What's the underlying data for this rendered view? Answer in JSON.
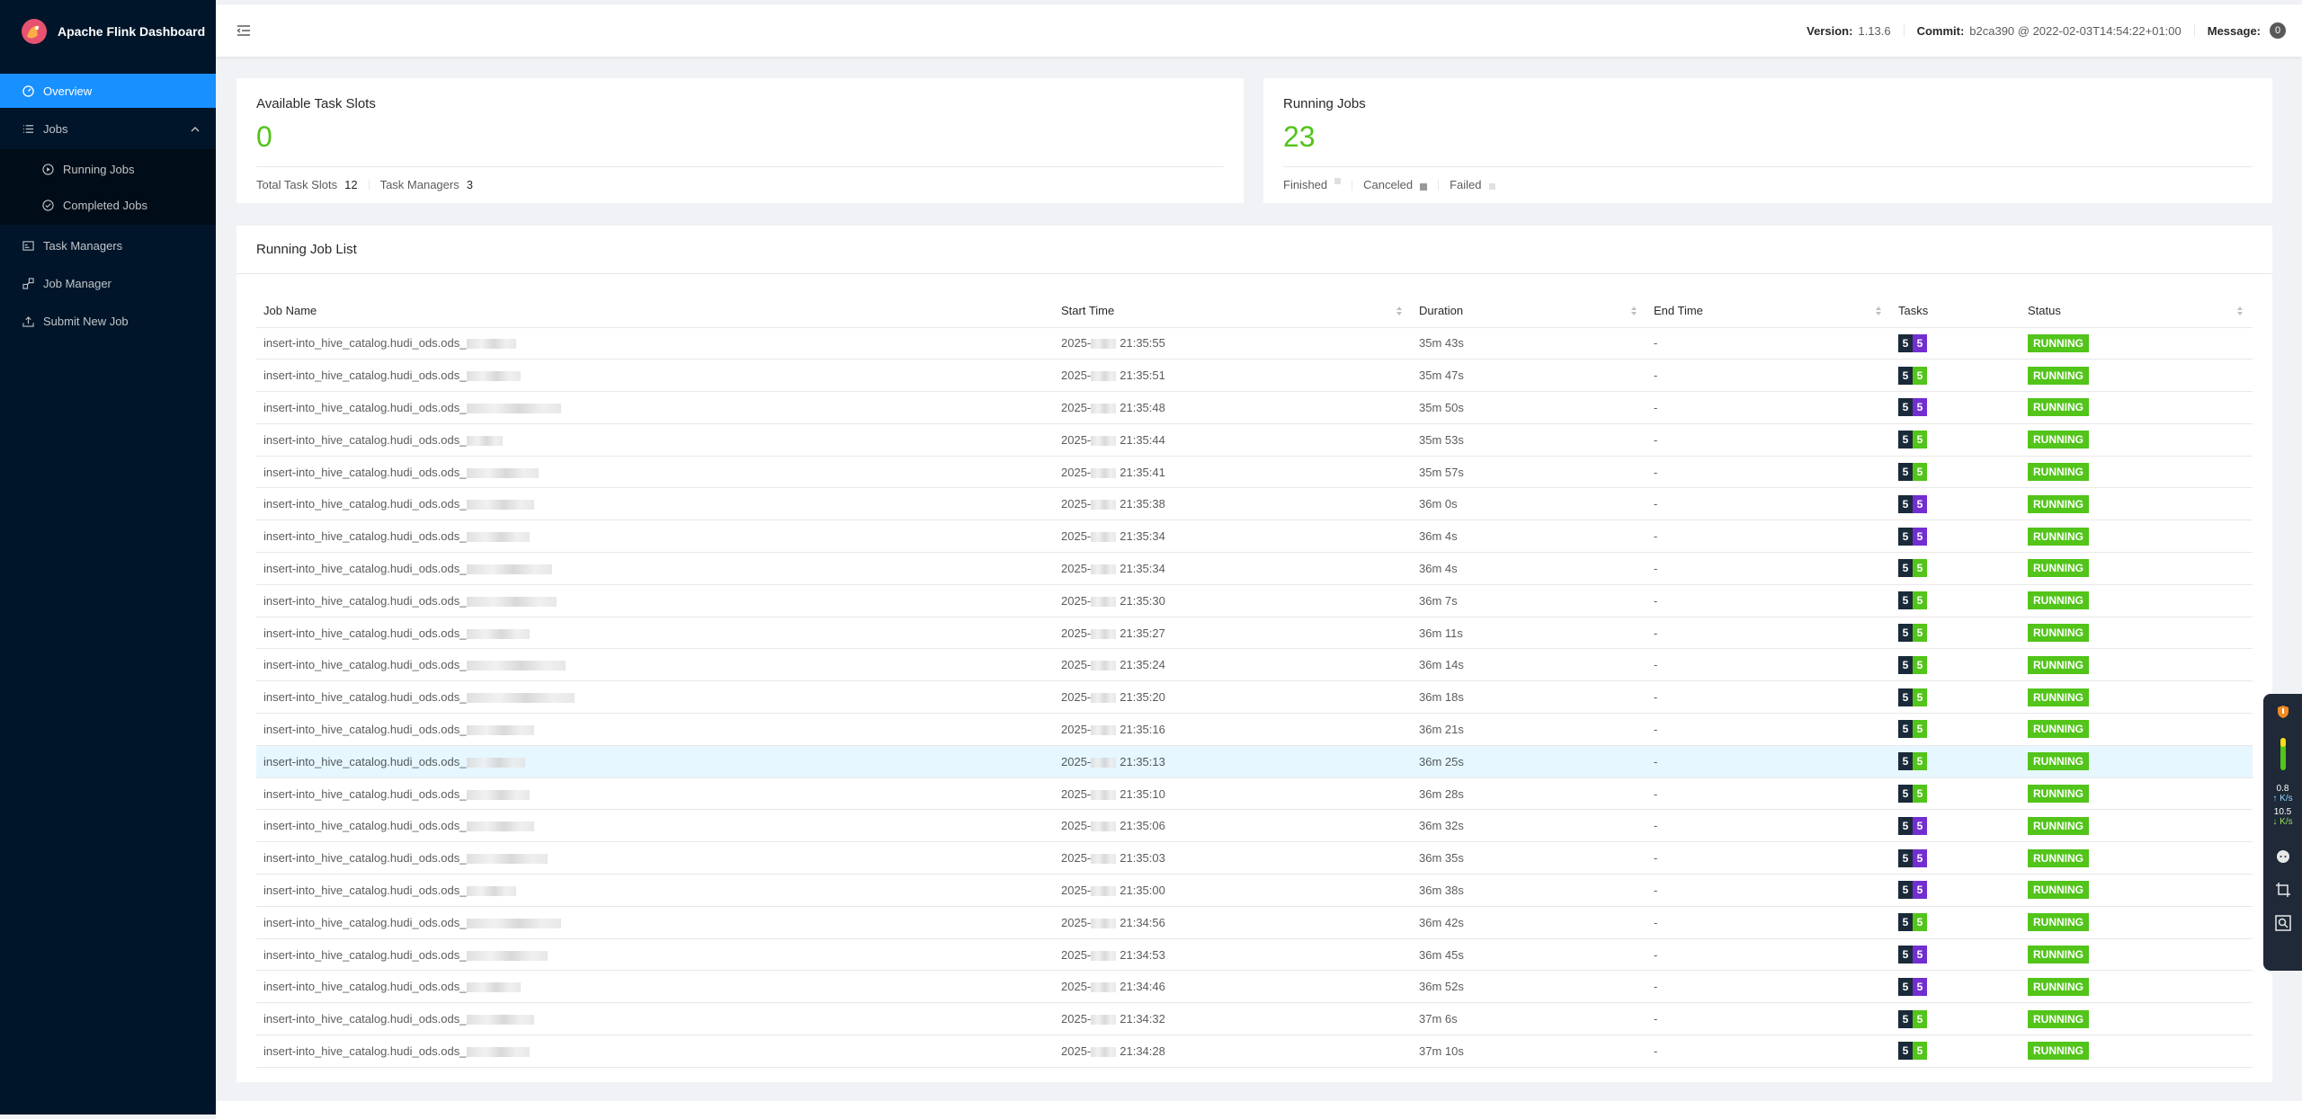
{
  "app": {
    "title": "Apache Flink Dashboard"
  },
  "sidebar": {
    "overview": "Overview",
    "jobs": "Jobs",
    "running_jobs": "Running Jobs",
    "completed_jobs": "Completed Jobs",
    "task_managers": "Task Managers",
    "job_manager": "Job Manager",
    "submit_new_job": "Submit New Job"
  },
  "header": {
    "version_label": "Version:",
    "version": "1.13.6",
    "commit_label": "Commit:",
    "commit": "b2ca390 @ 2022-02-03T14:54:22+01:00",
    "message_label": "Message:",
    "message_count": "0"
  },
  "slots": {
    "title": "Available Task Slots",
    "value": "0",
    "total_label": "Total Task Slots",
    "total_value": "12",
    "tm_label": "Task Managers",
    "tm_value": "3"
  },
  "running": {
    "title": "Running Jobs",
    "value": "23",
    "finished_label": "Finished",
    "canceled_label": "Canceled",
    "failed_label": "Failed"
  },
  "job_list": {
    "title": "Running Job List",
    "columns": [
      "Job Name",
      "Start Time",
      "Duration",
      "End Time",
      "Tasks",
      "Status"
    ],
    "rows": [
      {
        "name": "insert-into_hive_catalog.hudi_ods.ods_",
        "start_prefix": "2025-",
        "start_time": "21:35:55",
        "duration": "35m 43s",
        "end": "-",
        "tasks_a": "5",
        "tasks_b": "5",
        "tasks_color": "purple",
        "status": "RUNNING"
      },
      {
        "name": "insert-into_hive_catalog.hudi_ods.ods_",
        "start_prefix": "2025-",
        "start_time": "21:35:51",
        "duration": "35m 47s",
        "end": "-",
        "tasks_a": "5",
        "tasks_b": "5",
        "tasks_color": "green",
        "status": "RUNNING"
      },
      {
        "name": "insert-into_hive_catalog.hudi_ods.ods_",
        "start_prefix": "2025-",
        "start_time": "21:35:48",
        "duration": "35m 50s",
        "end": "-",
        "tasks_a": "5",
        "tasks_b": "5",
        "tasks_color": "purple",
        "status": "RUNNING"
      },
      {
        "name": "insert-into_hive_catalog.hudi_ods.ods_",
        "start_prefix": "2025-",
        "start_time": "21:35:44",
        "duration": "35m 53s",
        "end": "-",
        "tasks_a": "5",
        "tasks_b": "5",
        "tasks_color": "green",
        "status": "RUNNING"
      },
      {
        "name": "insert-into_hive_catalog.hudi_ods.ods_",
        "start_prefix": "2025-",
        "start_time": "21:35:41",
        "duration": "35m 57s",
        "end": "-",
        "tasks_a": "5",
        "tasks_b": "5",
        "tasks_color": "green",
        "status": "RUNNING"
      },
      {
        "name": "insert-into_hive_catalog.hudi_ods.ods_",
        "start_prefix": "2025-",
        "start_time": "21:35:38",
        "duration": "36m 0s",
        "end": "-",
        "tasks_a": "5",
        "tasks_b": "5",
        "tasks_color": "purple",
        "status": "RUNNING"
      },
      {
        "name": "insert-into_hive_catalog.hudi_ods.ods_",
        "start_prefix": "2025-",
        "start_time": "21:35:34",
        "duration": "36m 4s",
        "end": "-",
        "tasks_a": "5",
        "tasks_b": "5",
        "tasks_color": "purple",
        "status": "RUNNING"
      },
      {
        "name": "insert-into_hive_catalog.hudi_ods.ods_",
        "start_prefix": "2025-",
        "start_time": "21:35:34",
        "duration": "36m 4s",
        "end": "-",
        "tasks_a": "5",
        "tasks_b": "5",
        "tasks_color": "green",
        "status": "RUNNING"
      },
      {
        "name": "insert-into_hive_catalog.hudi_ods.ods_",
        "start_prefix": "2025-",
        "start_time": "21:35:30",
        "duration": "36m 7s",
        "end": "-",
        "tasks_a": "5",
        "tasks_b": "5",
        "tasks_color": "green",
        "status": "RUNNING"
      },
      {
        "name": "insert-into_hive_catalog.hudi_ods.ods_",
        "start_prefix": "2025-",
        "start_time": "21:35:27",
        "duration": "36m 11s",
        "end": "-",
        "tasks_a": "5",
        "tasks_b": "5",
        "tasks_color": "green",
        "status": "RUNNING"
      },
      {
        "name": "insert-into_hive_catalog.hudi_ods.ods_",
        "start_prefix": "2025-",
        "start_time": "21:35:24",
        "duration": "36m 14s",
        "end": "-",
        "tasks_a": "5",
        "tasks_b": "5",
        "tasks_color": "green",
        "status": "RUNNING"
      },
      {
        "name": "insert-into_hive_catalog.hudi_ods.ods_",
        "start_prefix": "2025-",
        "start_time": "21:35:20",
        "duration": "36m 18s",
        "end": "-",
        "tasks_a": "5",
        "tasks_b": "5",
        "tasks_color": "green",
        "status": "RUNNING"
      },
      {
        "name": "insert-into_hive_catalog.hudi_ods.ods_",
        "start_prefix": "2025-",
        "start_time": "21:35:16",
        "duration": "36m 21s",
        "end": "-",
        "tasks_a": "5",
        "tasks_b": "5",
        "tasks_color": "green",
        "status": "RUNNING"
      },
      {
        "name": "insert-into_hive_catalog.hudi_ods.ods_",
        "start_prefix": "2025-",
        "start_time": "21:35:13",
        "duration": "36m 25s",
        "end": "-",
        "tasks_a": "5",
        "tasks_b": "5",
        "tasks_color": "green",
        "status": "RUNNING"
      },
      {
        "name": "insert-into_hive_catalog.hudi_ods.ods_",
        "start_prefix": "2025-",
        "start_time": "21:35:10",
        "duration": "36m 28s",
        "end": "-",
        "tasks_a": "5",
        "tasks_b": "5",
        "tasks_color": "green",
        "status": "RUNNING"
      },
      {
        "name": "insert-into_hive_catalog.hudi_ods.ods_",
        "start_prefix": "2025-",
        "start_time": "21:35:06",
        "duration": "36m 32s",
        "end": "-",
        "tasks_a": "5",
        "tasks_b": "5",
        "tasks_color": "purple",
        "status": "RUNNING"
      },
      {
        "name": "insert-into_hive_catalog.hudi_ods.ods_",
        "start_prefix": "2025-",
        "start_time": "21:35:03",
        "duration": "36m 35s",
        "end": "-",
        "tasks_a": "5",
        "tasks_b": "5",
        "tasks_color": "purple",
        "status": "RUNNING"
      },
      {
        "name": "insert-into_hive_catalog.hudi_ods.ods_",
        "start_prefix": "2025-",
        "start_time": "21:35:00",
        "duration": "36m 38s",
        "end": "-",
        "tasks_a": "5",
        "tasks_b": "5",
        "tasks_color": "purple",
        "status": "RUNNING"
      },
      {
        "name": "insert-into_hive_catalog.hudi_ods.ods_",
        "start_prefix": "2025-",
        "start_time": "21:34:56",
        "duration": "36m 42s",
        "end": "-",
        "tasks_a": "5",
        "tasks_b": "5",
        "tasks_color": "green",
        "status": "RUNNING"
      },
      {
        "name": "insert-into_hive_catalog.hudi_ods.ods_",
        "start_prefix": "2025-",
        "start_time": "21:34:53",
        "duration": "36m 45s",
        "end": "-",
        "tasks_a": "5",
        "tasks_b": "5",
        "tasks_color": "purple",
        "status": "RUNNING"
      },
      {
        "name": "insert-into_hive_catalog.hudi_ods.ods_",
        "start_prefix": "2025-",
        "start_time": "21:34:46",
        "duration": "36m 52s",
        "end": "-",
        "tasks_a": "5",
        "tasks_b": "5",
        "tasks_color": "purple",
        "status": "RUNNING"
      },
      {
        "name": "insert-into_hive_catalog.hudi_ods.ods_",
        "start_prefix": "2025-",
        "start_time": "21:34:32",
        "duration": "37m 6s",
        "end": "-",
        "tasks_a": "5",
        "tasks_b": "5",
        "tasks_color": "green",
        "status": "RUNNING"
      },
      {
        "name": "insert-into_hive_catalog.hudi_ods.ods_",
        "start_prefix": "2025-",
        "start_time": "21:34:28",
        "duration": "37m 10s",
        "end": "-",
        "tasks_a": "5",
        "tasks_b": "5",
        "tasks_color": "green",
        "status": "RUNNING"
      }
    ]
  },
  "widget": {
    "upload_value": "0.8",
    "upload_unit": "K/s",
    "download_value": "10.5",
    "download_unit": "K/s"
  }
}
